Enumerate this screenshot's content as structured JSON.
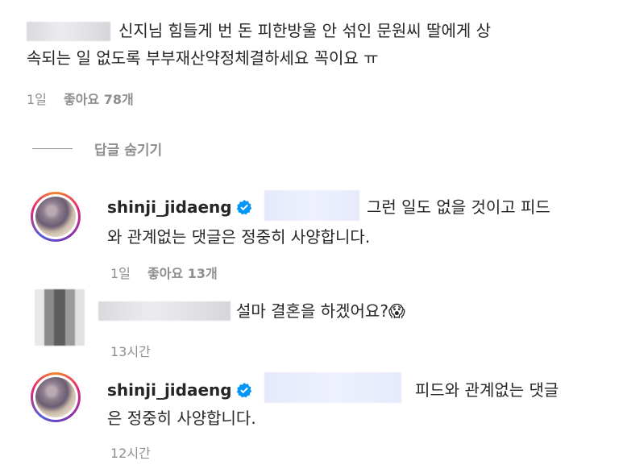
{
  "comments": [
    {
      "text_line1": "신지님 힘들게 번 돈 피한방울 안 섞인 문원씨 딸에게 상",
      "text_line2": "속되는 일 없도록 부부재산약정체결하세요 꼭이요 ㅠ",
      "time": "1일",
      "likes": "좋아요 78개"
    }
  ],
  "hide_replies_label": "답글 숨기기",
  "replies": [
    {
      "username": "shinji_jidaeng",
      "text_line1": "그런 일도 없을 것이고 피드",
      "text_line2": "와 관계없는 댓글은 정중히 사양합니다.",
      "time": "1일",
      "likes": "좋아요 13개"
    },
    {
      "text_line1": "설마 결혼을 하겠어요?😱",
      "time": "13시간"
    },
    {
      "username": "shinji_jidaeng",
      "text_line1": "피드와 관계없는 댓글",
      "text_line2": "은 정중히 사양합니다.",
      "time": "12시간"
    }
  ],
  "colors": {
    "text": "#262626",
    "meta": "#8e8e8e",
    "verified": "#0095f6"
  }
}
